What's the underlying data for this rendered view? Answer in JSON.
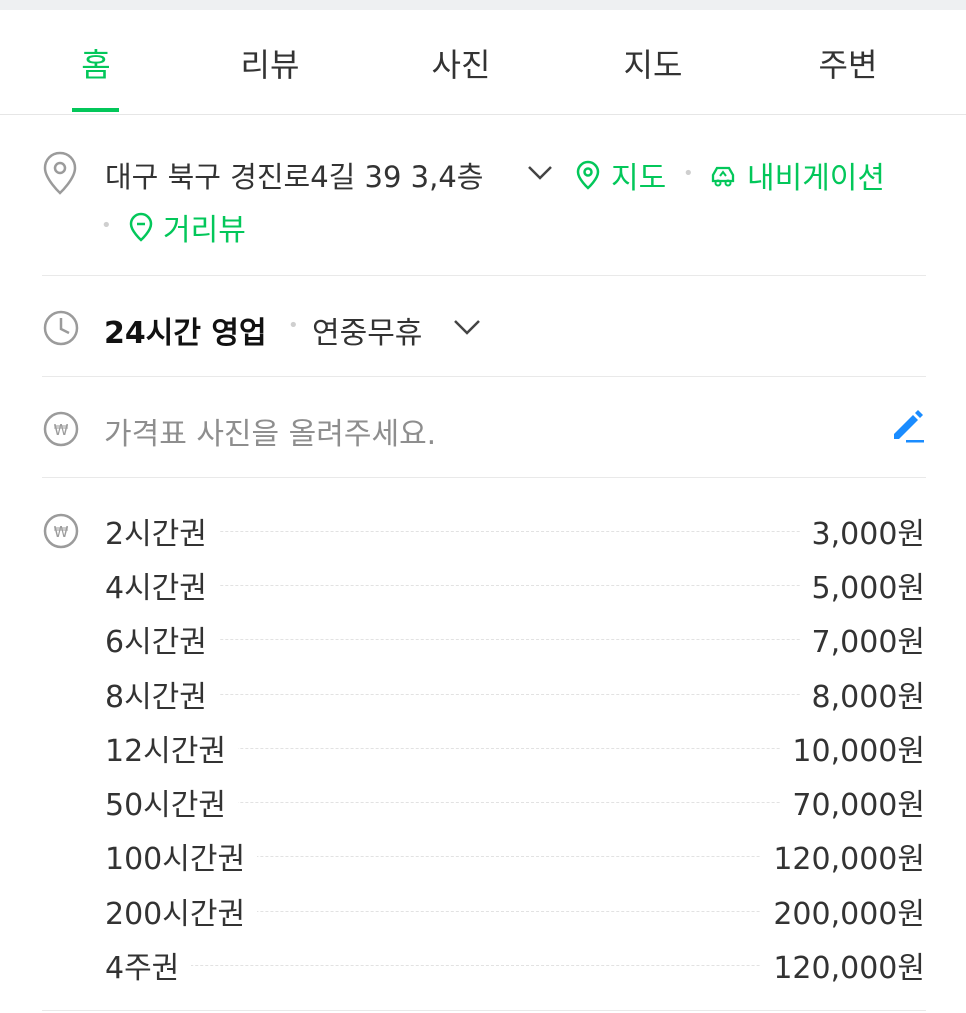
{
  "tabs": [
    {
      "label": "홈",
      "active": true
    },
    {
      "label": "리뷰"
    },
    {
      "label": "사진"
    },
    {
      "label": "지도"
    },
    {
      "label": "주변"
    }
  ],
  "location": {
    "address": "대구 북구 경진로4길 39 3,4층",
    "map_label": "지도",
    "navigation_label": "내비게이션",
    "streetview_label": "거리뷰"
  },
  "hours": {
    "status": "24시간 영업",
    "holiday": "연중무휴"
  },
  "menu_photo": {
    "prompt": "가격표 사진을 올려주세요."
  },
  "prices": [
    {
      "name": "2시간권",
      "price": "3,000원"
    },
    {
      "name": "4시간권",
      "price": "5,000원"
    },
    {
      "name": "6시간권",
      "price": "7,000원"
    },
    {
      "name": "8시간권",
      "price": "8,000원"
    },
    {
      "name": "12시간권",
      "price": "10,000원"
    },
    {
      "name": "50시간권",
      "price": "70,000원"
    },
    {
      "name": "100시간권",
      "price": "120,000원"
    },
    {
      "name": "200시간권",
      "price": "200,000원"
    },
    {
      "name": "4주권",
      "price": "120,000원"
    }
  ],
  "colors": {
    "accent": "#03c75a",
    "edit": "#1a8cff"
  }
}
